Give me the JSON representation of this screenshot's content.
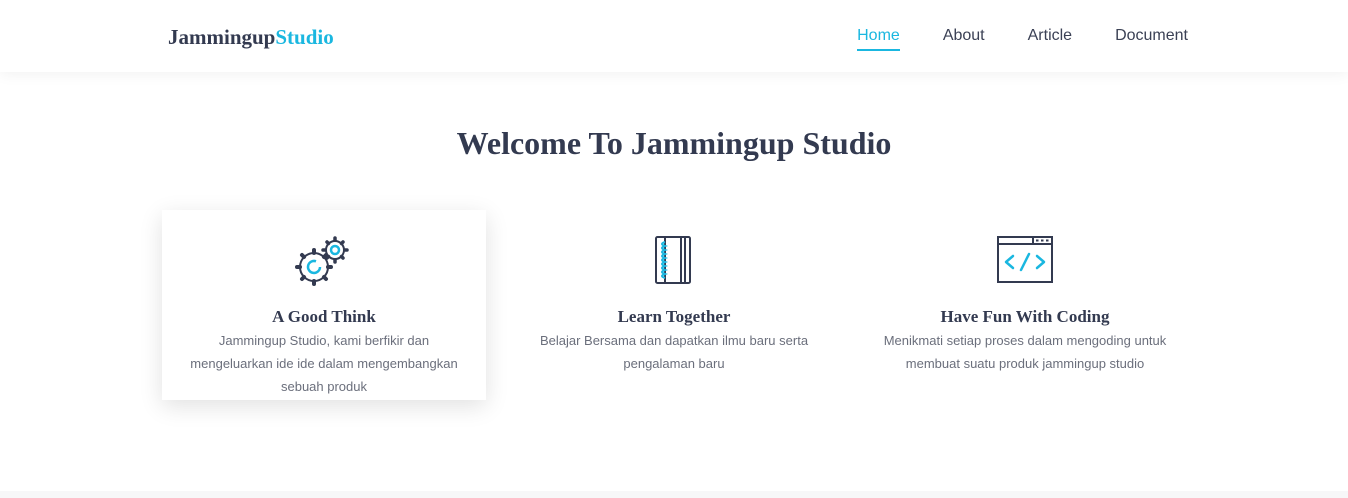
{
  "brand": {
    "name_main": "Jammingup",
    "name_accent": "Studio"
  },
  "nav": {
    "items": [
      {
        "label": "Home",
        "active": true
      },
      {
        "label": "About",
        "active": false
      },
      {
        "label": "Article",
        "active": false
      },
      {
        "label": "Document",
        "active": false
      }
    ]
  },
  "hero": {
    "title": "Welcome To Jammingup Studio"
  },
  "features": [
    {
      "icon": "gears-icon",
      "title": "A Good Think",
      "text": "Jammingup Studio, kami berfikir dan mengeluarkan ide ide dalam mengembangkan sebuah produk"
    },
    {
      "icon": "notebook-icon",
      "title": "Learn Together",
      "text": "Belajar Bersama dan dapatkan ilmu baru serta pengalaman baru"
    },
    {
      "icon": "code-window-icon",
      "title": "Have Fun With Coding",
      "text": "Menikmati setiap proses dalam mengoding untuk membuat suatu produk jammingup studio"
    }
  ],
  "colors": {
    "accent": "#1ab7e0",
    "dark": "#333a50",
    "muted": "#6b6f7c"
  }
}
